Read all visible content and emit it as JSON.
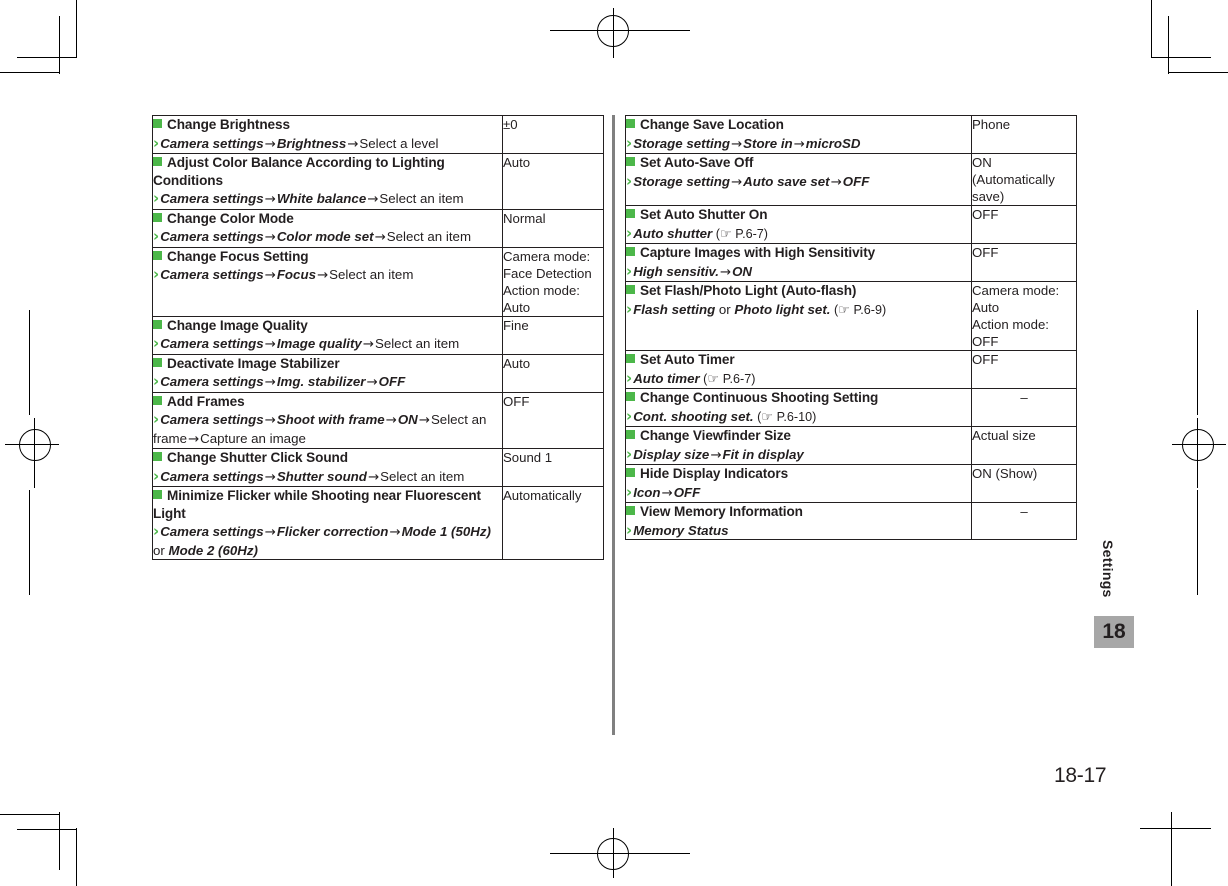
{
  "page": {
    "number": "18-17",
    "side_tab_label": "Settings",
    "side_tab_number": "18",
    "accent_green": "#4CB749",
    "text_color": "#231f20",
    "divider_color": "#808080",
    "tab_bg": "#a7a7a7"
  },
  "icons": {
    "bullet": "green-square-bullet",
    "chevron": "›",
    "arrow": "→",
    "hand": "☞"
  },
  "left_table": {
    "rows": [
      {
        "heading": "Change Brightness",
        "steps": [
          [
            {
              "t": "Camera settings",
              "s": "bi"
            },
            {
              "t": "→",
              "s": "arr"
            },
            {
              "t": "Brightness",
              "s": "bi"
            },
            {
              "t": "→",
              "s": "arr"
            },
            {
              "t": "Select a level",
              "s": "plain"
            }
          ]
        ],
        "value": "±0"
      },
      {
        "heading": "Adjust Color Balance According to Lighting Conditions",
        "steps": [
          [
            {
              "t": "Camera settings",
              "s": "bi"
            },
            {
              "t": "→",
              "s": "arr"
            },
            {
              "t": "White balance",
              "s": "bi"
            },
            {
              "t": "→",
              "s": "arr"
            },
            {
              "t": "Select an item",
              "s": "plain"
            }
          ]
        ],
        "value": "Auto"
      },
      {
        "heading": "Change Color Mode",
        "steps": [
          [
            {
              "t": "Camera settings",
              "s": "bi"
            },
            {
              "t": "→",
              "s": "arr"
            },
            {
              "t": "Color mode set",
              "s": "bi"
            },
            {
              "t": "→",
              "s": "arr"
            },
            {
              "t": "Select an item",
              "s": "plain"
            }
          ]
        ],
        "value": "Normal"
      },
      {
        "heading": "Change Focus Setting",
        "steps": [
          [
            {
              "t": "Camera settings",
              "s": "bi"
            },
            {
              "t": "→",
              "s": "arr"
            },
            {
              "t": "Focus",
              "s": "bi"
            },
            {
              "t": "→",
              "s": "arr"
            },
            {
              "t": "Select an item",
              "s": "plain"
            }
          ]
        ],
        "value": "Camera mode:\nFace Detection\nAction mode:\nAuto"
      },
      {
        "heading": "Change Image Quality",
        "steps": [
          [
            {
              "t": "Camera settings",
              "s": "bi"
            },
            {
              "t": "→",
              "s": "arr"
            },
            {
              "t": "Image quality",
              "s": "bi"
            },
            {
              "t": "→",
              "s": "arr"
            },
            {
              "t": "Select an item",
              "s": "plain"
            }
          ]
        ],
        "value": "Fine"
      },
      {
        "heading": "Deactivate Image Stabilizer",
        "steps": [
          [
            {
              "t": "Camera settings",
              "s": "bi"
            },
            {
              "t": "→",
              "s": "arr"
            },
            {
              "t": "Img. stabilizer",
              "s": "bi"
            },
            {
              "t": "→",
              "s": "arr"
            },
            {
              "t": "OFF",
              "s": "bi"
            }
          ]
        ],
        "value": "Auto"
      },
      {
        "heading": "Add Frames",
        "steps": [
          [
            {
              "t": "Camera settings",
              "s": "bi"
            },
            {
              "t": "→",
              "s": "arr"
            },
            {
              "t": "Shoot with frame",
              "s": "bi"
            },
            {
              "t": "→",
              "s": "arr"
            },
            {
              "t": "ON",
              "s": "bi"
            },
            {
              "t": "→",
              "s": "arr"
            },
            {
              "t": "Select an frame",
              "s": "plain"
            },
            {
              "t": "→",
              "s": "arr"
            },
            {
              "t": "Capture an image",
              "s": "plain"
            }
          ]
        ],
        "value": "OFF"
      },
      {
        "heading": "Change Shutter Click Sound",
        "steps": [
          [
            {
              "t": "Camera settings",
              "s": "bi"
            },
            {
              "t": "→",
              "s": "arr"
            },
            {
              "t": "Shutter sound",
              "s": "bi"
            },
            {
              "t": "→",
              "s": "arr"
            },
            {
              "t": "Select an item",
              "s": "plain"
            }
          ]
        ],
        "value": "Sound 1"
      },
      {
        "heading": "Minimize Flicker while Shooting near Fluorescent Light",
        "steps": [
          [
            {
              "t": "Camera settings",
              "s": "bi"
            },
            {
              "t": "→",
              "s": "arr"
            },
            {
              "t": "Flicker correction",
              "s": "bi"
            },
            {
              "t": "→",
              "s": "arr"
            },
            {
              "t": "Mode 1 (50Hz)",
              "s": "bi"
            },
            {
              "t": " or ",
              "s": "plain"
            },
            {
              "t": "Mode 2 (60Hz)",
              "s": "bi"
            }
          ]
        ],
        "value": "Automatically"
      }
    ]
  },
  "right_table": {
    "rows": [
      {
        "heading": "Change Save Location",
        "steps": [
          [
            {
              "t": "Storage setting",
              "s": "bi"
            },
            {
              "t": "→",
              "s": "arr"
            },
            {
              "t": "Store in",
              "s": "bi"
            },
            {
              "t": "→",
              "s": "arr"
            },
            {
              "t": "microSD",
              "s": "bi"
            }
          ]
        ],
        "value": "Phone"
      },
      {
        "heading": "Set Auto-Save Off",
        "steps": [
          [
            {
              "t": "Storage setting",
              "s": "bi"
            },
            {
              "t": "→",
              "s": "arr"
            },
            {
              "t": "Auto save set",
              "s": "bi"
            },
            {
              "t": "→",
              "s": "arr"
            },
            {
              "t": "OFF",
              "s": "bi"
            }
          ]
        ],
        "value": "ON\n(Automatically\nsave)"
      },
      {
        "heading": "Set Auto Shutter On",
        "steps": [
          [
            {
              "t": "Auto shutter",
              "s": "bi"
            },
            {
              "t": " (",
              "s": "ref"
            },
            {
              "t": "☞",
              "s": "hand"
            },
            {
              "t": "P.6-7)",
              "s": "ref"
            }
          ]
        ],
        "value": "OFF"
      },
      {
        "heading": "Capture Images with High Sensitivity",
        "steps": [
          [
            {
              "t": "High sensitiv.",
              "s": "bi"
            },
            {
              "t": "→",
              "s": "arr"
            },
            {
              "t": "ON",
              "s": "bi"
            }
          ]
        ],
        "value": "OFF"
      },
      {
        "heading": "Set Flash/Photo Light (Auto-flash)",
        "steps": [
          [
            {
              "t": "Flash setting",
              "s": "bi"
            },
            {
              "t": " or ",
              "s": "plain"
            },
            {
              "t": "Photo light set.",
              "s": "bi"
            },
            {
              "t": " (",
              "s": "ref"
            },
            {
              "t": "☞",
              "s": "hand"
            },
            {
              "t": "P.6-9)",
              "s": "ref"
            }
          ]
        ],
        "value": "Camera mode:\nAuto\nAction mode:\nOFF"
      },
      {
        "heading": "Set Auto Timer",
        "steps": [
          [
            {
              "t": "Auto timer",
              "s": "bi"
            },
            {
              "t": " (",
              "s": "ref"
            },
            {
              "t": "☞",
              "s": "hand"
            },
            {
              "t": "P.6-7)",
              "s": "ref"
            }
          ]
        ],
        "value": "OFF"
      },
      {
        "heading": "Change Continuous Shooting Setting",
        "steps": [
          [
            {
              "t": "Cont. shooting set.",
              "s": "bi"
            },
            {
              "t": " (",
              "s": "ref"
            },
            {
              "t": "☞",
              "s": "hand"
            },
            {
              "t": "P.6-10)",
              "s": "ref"
            }
          ]
        ],
        "value": "–",
        "center": true
      },
      {
        "heading": "Change Viewfinder Size",
        "steps": [
          [
            {
              "t": "Display size",
              "s": "bi"
            },
            {
              "t": "→",
              "s": "arr"
            },
            {
              "t": "Fit in display",
              "s": "bi"
            }
          ]
        ],
        "value": "Actual size"
      },
      {
        "heading": "Hide Display Indicators",
        "steps": [
          [
            {
              "t": "Icon",
              "s": "bi"
            },
            {
              "t": "→",
              "s": "arr"
            },
            {
              "t": "OFF",
              "s": "bi"
            }
          ]
        ],
        "value": "ON (Show)"
      },
      {
        "heading": "View Memory Information",
        "steps": [
          [
            {
              "t": "Memory Status",
              "s": "bi"
            }
          ]
        ],
        "value": "–",
        "center": true
      }
    ]
  }
}
